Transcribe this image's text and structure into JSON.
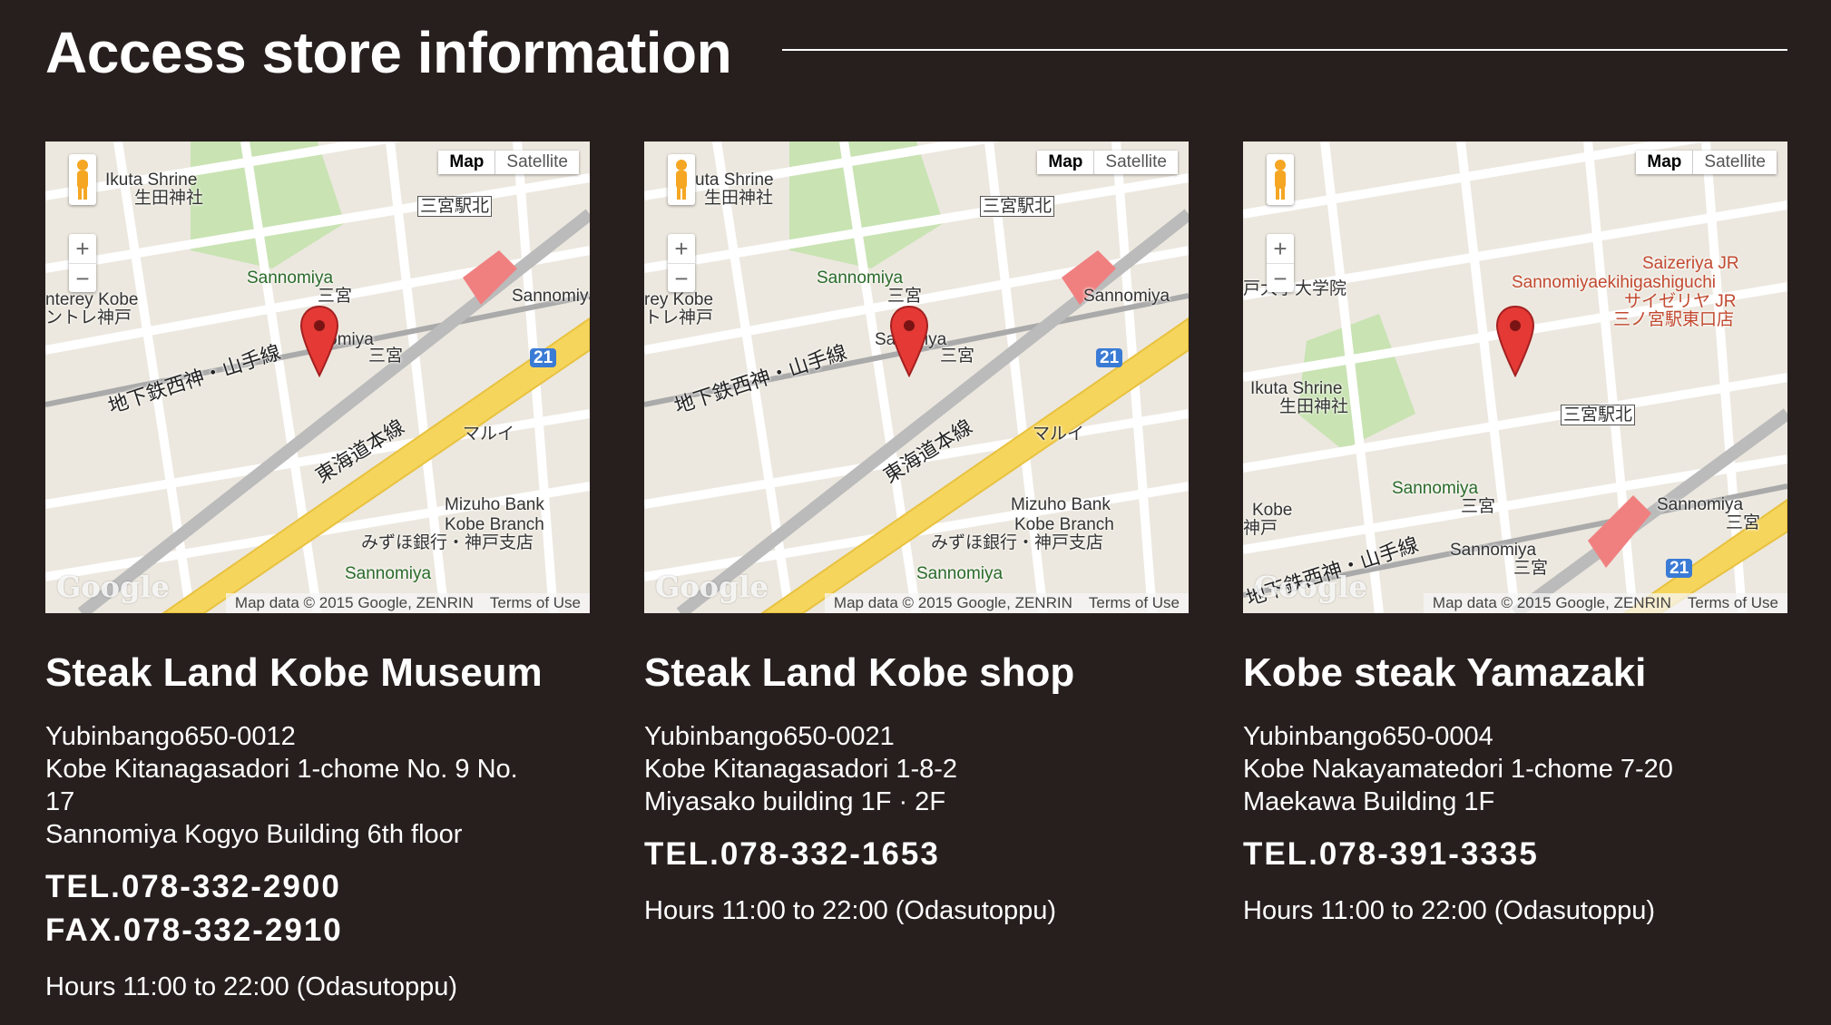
{
  "page": {
    "title": "Access store information"
  },
  "stores": [
    {
      "name": "Steak Land Kobe Museum",
      "address": [
        "Yubinbango650-0012",
        "Kobe Kitanagasadori 1-chome No. 9 No.",
        "17",
        "Sannomiya Kogyo Building 6th floor"
      ],
      "tel": "TEL.078-332-2900",
      "fax": "FAX.078-332-2910",
      "hours": "Hours 11:00 to 22:00 (Odasutoppu)",
      "map": {
        "type_map": "Map",
        "type_satellite": "Satellite",
        "zoom_in": "+",
        "zoom_out": "−",
        "labels": {
          "ikuta": "Ikuta Shrine",
          "ikuta_jp": "生田神社",
          "kitaguchi": "三宮駅北",
          "sannomiya1": "Sannomiya",
          "sannomiya1_jp": "三宮",
          "monterey": "nterey Kobe",
          "monterey_jp": "ントレ神戸",
          "sannomiya2": "Sannomiya",
          "sannomiya3": "nnomiya",
          "sannomiya3_jp": "三宮",
          "line": "地下鉄西神・山手線",
          "tokaido": "東海道本線",
          "marui": "マルイ",
          "mizuho": "Mizuho Bank",
          "mizuho2": "Kobe Branch",
          "mizuho_jp": "みずほ銀行・神戸支店",
          "hanadokei": "Sannomiya",
          "route": "21"
        },
        "google": "Google",
        "attribution": "Map data © 2015 Google, ZENRIN",
        "terms": "Terms of Use"
      }
    },
    {
      "name": "Steak Land Kobe shop",
      "address": [
        "Yubinbango650-0021",
        "Kobe Kitanagasadori 1-8-2",
        "Miyasako building 1F · 2F"
      ],
      "tel": "TEL.078-332-1653",
      "hours": "Hours 11:00 to 22:00 (Odasutoppu)",
      "map": {
        "type_map": "Map",
        "type_satellite": "Satellite",
        "zoom_in": "+",
        "zoom_out": "−",
        "labels": {
          "ikuta": "uta Shrine",
          "ikuta_jp": "生田神社",
          "kitaguchi": "三宮駅北",
          "sannomiya1": "Sannomiya",
          "sannomiya1_jp": "三宮",
          "monterey": "rey Kobe",
          "monterey_jp": "トレ神戸",
          "sannomiya2": "Sannomiya",
          "sannomiya3": "San   miya",
          "sannomiya3_jp": "三宮",
          "line": "地下鉄西神・山手線",
          "tokaido": "東海道本線",
          "marui": "マルイ",
          "mizuho": "Mizuho Bank",
          "mizuho2": "Kobe Branch",
          "mizuho_jp": "みずほ銀行・神戸支店",
          "hanadokei": "Sannomiya",
          "route": "21"
        },
        "google": "Google",
        "attribution": "Map data © 2015 Google, ZENRIN",
        "terms": "Terms of Use"
      }
    },
    {
      "name": "Kobe steak Yamazaki",
      "address": [
        "Yubinbango650-0004",
        "Kobe Nakayamatedori 1-chome 7-20",
        "Maekawa Building 1F"
      ],
      "tel": "TEL.078-391-3335",
      "hours": "Hours 11:00 to 22:00 (Odasutoppu)",
      "map": {
        "type_map": "Map",
        "type_satellite": "Satellite",
        "zoom_in": "+",
        "zoom_out": "−",
        "labels": {
          "saizeriya": "Saizeriya JR",
          "saizeriya2": "Sannomiyaekihigashiguchi",
          "saizeriya_jp": "サイゼリヤ JR",
          "saizeriya_jp2": "三ノ宮駅東口店",
          "univ": "戸大学大学院",
          "ikuta": "Ikuta Shrine",
          "ikuta_jp": "生田神社",
          "kitaguchi": "三宮駅北",
          "sannomiya1": "Sannomiya",
          "sannomiya1_jp": "三宮",
          "kobe": "Kobe",
          "kobe_jp": "神戸",
          "sannomiya2": "Sannomiya",
          "sannomiya2_jp": "三宮",
          "sannomiya3": "Sannomiya",
          "sannomiya3_jp": "三宮",
          "line": "地下鉄西神・山手線",
          "route": "21"
        },
        "google": "Google",
        "attribution": "Map data © 2015 Google, ZENRIN",
        "terms": "Terms of Use"
      }
    }
  ],
  "colors": {
    "background": "#271f1e",
    "text": "#ffffff",
    "pin": "#e53935",
    "road_yellow": "#f6d55c"
  }
}
